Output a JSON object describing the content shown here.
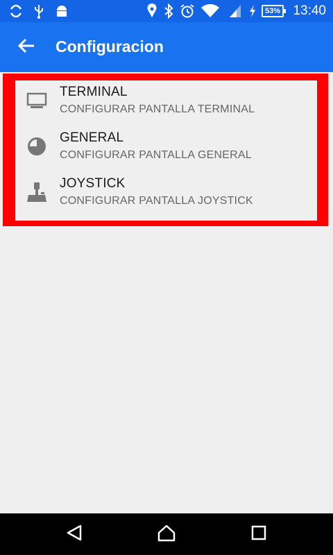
{
  "status_bar": {
    "time": "13:40",
    "battery": "53%",
    "icons": [
      "sync-icon",
      "usb-icon",
      "android-icon",
      "location-icon",
      "bluetooth-icon",
      "alarm-icon",
      "wifi-icon",
      "signal-icon",
      "charging-icon"
    ]
  },
  "app_bar": {
    "title": "Configuracion",
    "back_icon": "back-arrow-icon",
    "color": "#1973f0"
  },
  "settings": {
    "items": [
      {
        "title": "TERMINAL",
        "subtitle": "CONFIGURAR PANTALLA TERMINAL",
        "icon": "monitor-icon"
      },
      {
        "title": "GENERAL",
        "subtitle": "CONFIGURAR PANTALLA GENERAL",
        "icon": "pie-chart-icon"
      },
      {
        "title": "JOYSTICK",
        "subtitle": "CONFIGURAR PANTALLA JOYSTICK",
        "icon": "joystick-icon"
      }
    ]
  },
  "highlight": {
    "color": "#ff0000"
  },
  "nav_bar": {
    "buttons": [
      "back-triangle-icon",
      "home-icon",
      "recents-icon"
    ]
  }
}
